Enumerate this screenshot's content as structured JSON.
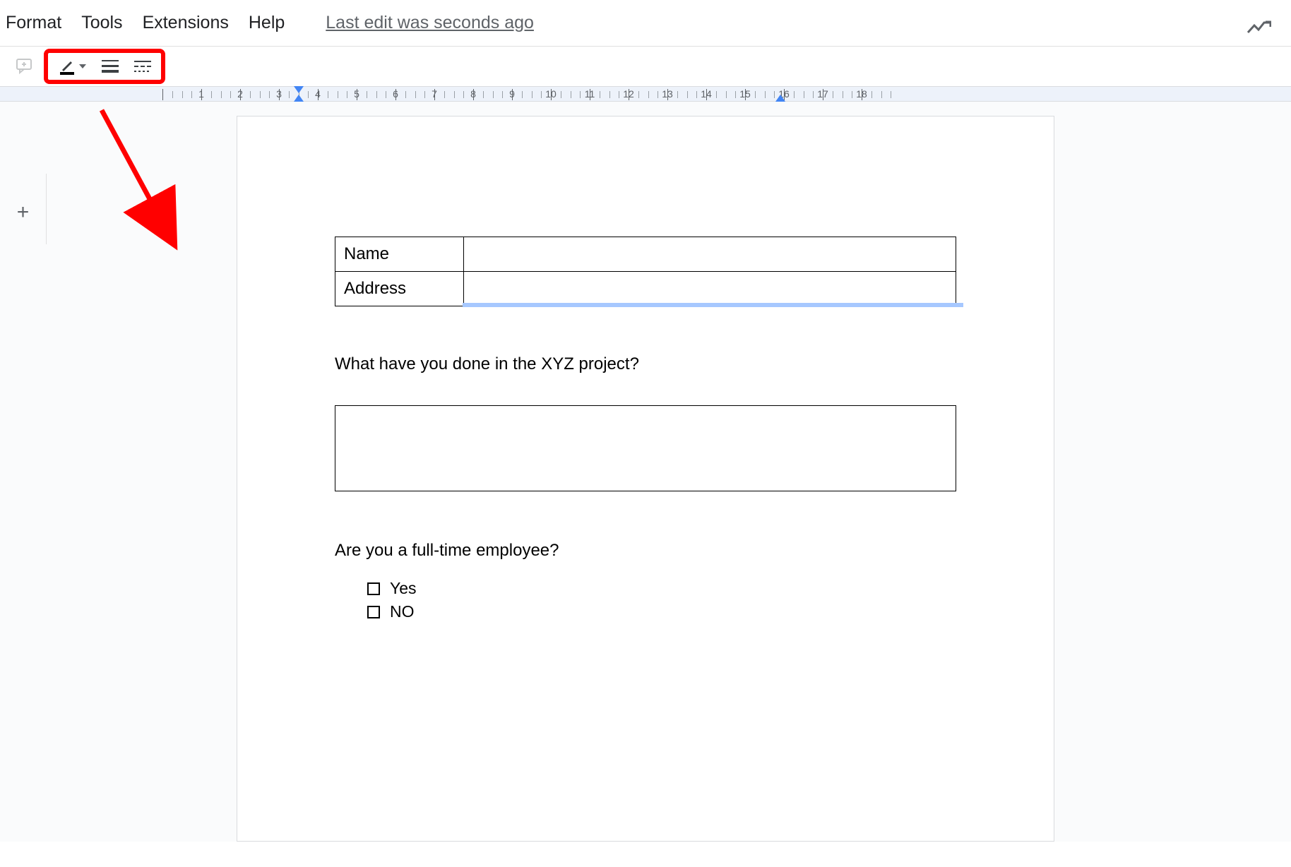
{
  "menu": {
    "format": "Format",
    "tools": "Tools",
    "extensions": "Extensions",
    "help": "Help",
    "edit_status": "Last edit was seconds ago"
  },
  "ruler": {
    "numbers": [
      1,
      2,
      3,
      4,
      5,
      6,
      7,
      8,
      9,
      10,
      11,
      12,
      13,
      14,
      15,
      16,
      17,
      18
    ]
  },
  "document": {
    "table": {
      "row1_label": "Name",
      "row1_value": "",
      "row2_label": "Address",
      "row2_value": ""
    },
    "question1": "What have you done in the XYZ project?",
    "question2": "Are you a full-time employee?",
    "options": {
      "opt1": "Yes",
      "opt2": "NO"
    }
  }
}
